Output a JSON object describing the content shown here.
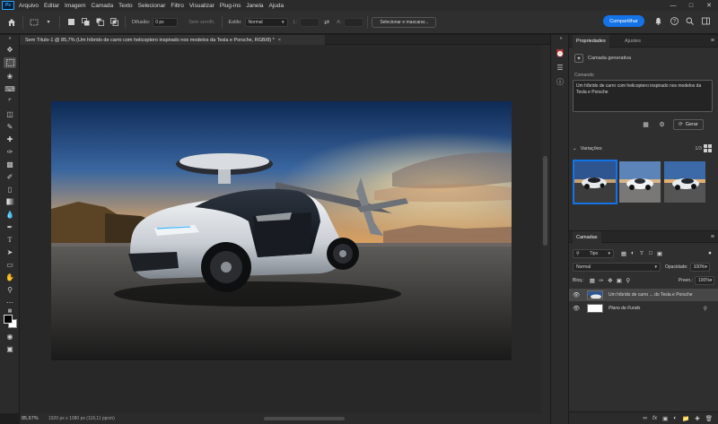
{
  "menubar": {
    "logo": "Ps",
    "items": [
      "Arquivo",
      "Editar",
      "Imagem",
      "Camada",
      "Texto",
      "Selecionar",
      "Filtro",
      "Visualizar",
      "Plug-ins",
      "Janela",
      "Ajuda"
    ]
  },
  "options": {
    "feather_label": "Difusão:",
    "feather_value": "0 px",
    "antialias_label": "Sem serrilh.",
    "style_label": "Estilo:",
    "style_value": "Normal",
    "width_label": "L:",
    "height_label": "A:",
    "select_mask_label": "Selecionar e mascarar..."
  },
  "share_label": "Compartilhar",
  "document_tab": {
    "title": "Sem Título-1 @ 85,7% (Um híbrido de carro com helicoptero inspirado nos modelos da Tesla e Porsche, RGB/8) *",
    "close": "×"
  },
  "status": {
    "zoom": "85,67%",
    "info": "1920 px x 1080 px (118,11 ppcm)"
  },
  "properties": {
    "tab_properties": "Propriedades",
    "tab_adjustments": "Ajustes",
    "layer_type": "Camada generativa",
    "prompt_label": "Comando",
    "prompt_text": "Um híbrido de carro com helicoptero inspirado nos modelos da Tesla e Porsche",
    "generate_label": "Gerar",
    "variations_label": "Variações",
    "variations_count": "1/3"
  },
  "layers": {
    "tab_layers": "Camadas",
    "filter_value": "Tipo",
    "blend_value": "Normal",
    "opacity_label": "Opacidade:",
    "opacity_value": "100%",
    "lock_label": "Bloq.:",
    "fill_label": "Preen.:",
    "fill_value": "100%",
    "items": [
      {
        "name": "Um híbrido de carro ... do Tesla e Porsche"
      },
      {
        "name": "Plano de Fundo"
      }
    ]
  },
  "colors": {
    "accent": "#1473e6",
    "panel": "#2f2f2f",
    "canvas_bg": "#282828"
  }
}
